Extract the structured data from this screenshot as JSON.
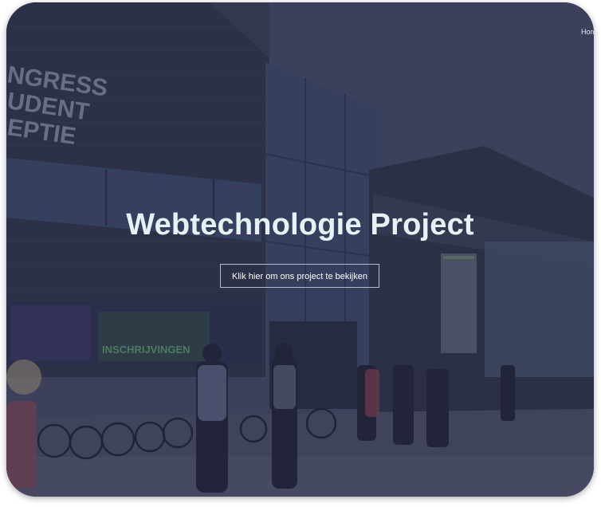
{
  "nav": {
    "home_label": "Home"
  },
  "hero": {
    "title": "Webtechnologie Project",
    "button_label": "Klik hier om ons project te bekijken"
  },
  "background": {
    "building_sign": [
      "NGRESS",
      "UDENT",
      "EPTIE"
    ],
    "window_sign": "INSCHRIJVINGEN"
  },
  "colors": {
    "overlay": "#3a3e52",
    "title": "#e6f2f5",
    "button_border": "#b9bccb"
  }
}
